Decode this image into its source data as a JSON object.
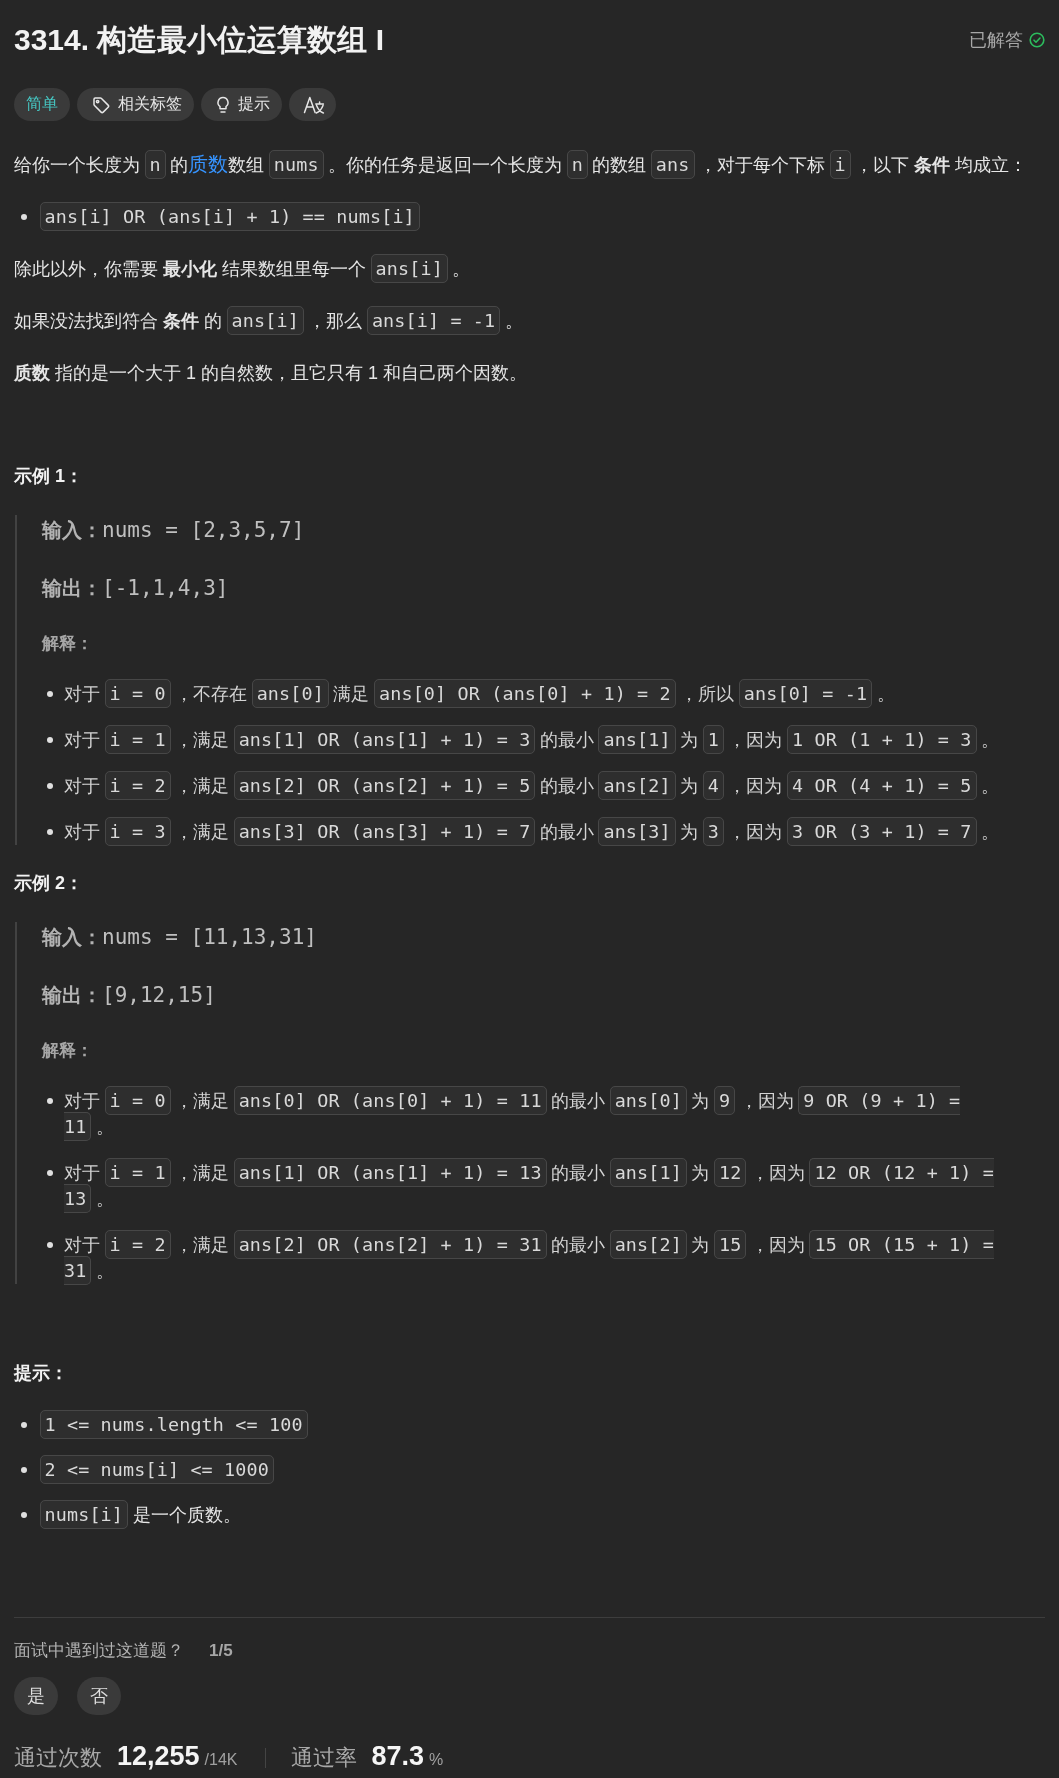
{
  "title": "3314. 构造最小位运算数组 I",
  "status": {
    "label": "已解答",
    "solved": true
  },
  "tags": [
    {
      "kind": "difficulty",
      "label": "简单"
    },
    {
      "kind": "topics",
      "label": "相关标签"
    },
    {
      "kind": "hint",
      "label": "提示"
    },
    {
      "kind": "translate"
    }
  ],
  "description": [
    {
      "kind": "paragraph",
      "segments": [
        {
          "kind": "text",
          "text": "给你一个长度为"
        },
        {
          "kind": "code",
          "text": "n"
        },
        {
          "kind": "text",
          "text": "的"
        },
        {
          "kind": "link",
          "text": "质数"
        },
        {
          "kind": "text",
          "text": "数组"
        },
        {
          "kind": "code",
          "text": "nums"
        },
        {
          "kind": "text",
          "text": "。你的任务是返回一个长度为"
        },
        {
          "kind": "code",
          "text": "n"
        },
        {
          "kind": "text",
          "text": "的数组"
        },
        {
          "kind": "code",
          "text": "ans"
        },
        {
          "kind": "text",
          "text": "，对于每个下标"
        },
        {
          "kind": "code",
          "text": "i"
        },
        {
          "kind": "text",
          "text": "，以下 **条件** 均成立："
        }
      ]
    },
    {
      "kind": "bullets",
      "items": [
        {
          "segments": [
            {
              "kind": "code",
              "text": "ans[i] OR (ans[i] + 1) == nums[i]"
            }
          ]
        }
      ]
    },
    {
      "kind": "paragraph",
      "segments": [
        {
          "kind": "text",
          "text": "除此以外，你需要 **最小化** 结果数组里每一个"
        },
        {
          "kind": "code",
          "text": "ans[i]"
        },
        {
          "kind": "text",
          "text": "。"
        }
      ]
    },
    {
      "kind": "paragraph",
      "segments": [
        {
          "kind": "text",
          "text": "如果没法找到符合 **条件** 的"
        },
        {
          "kind": "code",
          "text": "ans[i]"
        },
        {
          "kind": "text",
          "text": "，那么"
        },
        {
          "kind": "code",
          "text": "ans[i] = -1"
        },
        {
          "kind": "text",
          "text": "。"
        }
      ]
    },
    {
      "kind": "paragraph",
      "segments": [
        {
          "kind": "text",
          "text": "**质数** 指的是一个大于 1 的自然数，且它只有 1 和自己两个因数。"
        }
      ]
    }
  ],
  "examples": [
    {
      "heading": "示例 1：",
      "input_label": "输入：",
      "input": "nums = [2,3,5,7]",
      "output_label": "输出：",
      "output": "[-1,1,4,3]",
      "explanation_label": "解释：",
      "explanation": [
        {
          "segments": [
            {
              "kind": "text",
              "text": "对于"
            },
            {
              "kind": "code",
              "text": "i = 0"
            },
            {
              "kind": "text",
              "text": "，不存在"
            },
            {
              "kind": "code",
              "text": "ans[0]"
            },
            {
              "kind": "text",
              "text": "满足"
            },
            {
              "kind": "code",
              "text": "ans[0] OR (ans[0] + 1) = 2"
            },
            {
              "kind": "text",
              "text": "，所以"
            },
            {
              "kind": "code",
              "text": "ans[0] = -1"
            },
            {
              "kind": "text",
              "text": "。"
            }
          ]
        },
        {
          "segments": [
            {
              "kind": "text",
              "text": "对于"
            },
            {
              "kind": "code",
              "text": "i = 1"
            },
            {
              "kind": "text",
              "text": "，满足"
            },
            {
              "kind": "code",
              "text": "ans[1] OR (ans[1] + 1) = 3"
            },
            {
              "kind": "text",
              "text": "的最小"
            },
            {
              "kind": "code",
              "text": "ans[1]"
            },
            {
              "kind": "text",
              "text": "为"
            },
            {
              "kind": "code",
              "text": "1"
            },
            {
              "kind": "text",
              "text": "，因为"
            },
            {
              "kind": "code",
              "text": "1 OR (1 + 1) = 3"
            },
            {
              "kind": "text",
              "text": "。"
            }
          ]
        },
        {
          "segments": [
            {
              "kind": "text",
              "text": "对于"
            },
            {
              "kind": "code",
              "text": "i = 2"
            },
            {
              "kind": "text",
              "text": "，满足"
            },
            {
              "kind": "code",
              "text": "ans[2] OR (ans[2] + 1) = 5"
            },
            {
              "kind": "text",
              "text": "的最小"
            },
            {
              "kind": "code",
              "text": "ans[2]"
            },
            {
              "kind": "text",
              "text": "为"
            },
            {
              "kind": "code",
              "text": "4"
            },
            {
              "kind": "text",
              "text": "，因为"
            },
            {
              "kind": "code",
              "text": "4 OR (4 + 1) = 5"
            },
            {
              "kind": "text",
              "text": "。"
            }
          ]
        },
        {
          "segments": [
            {
              "kind": "text",
              "text": "对于"
            },
            {
              "kind": "code",
              "text": "i = 3"
            },
            {
              "kind": "text",
              "text": "，满足"
            },
            {
              "kind": "code",
              "text": "ans[3] OR (ans[3] + 1) = 7"
            },
            {
              "kind": "text",
              "text": "的最小"
            },
            {
              "kind": "code",
              "text": "ans[3]"
            },
            {
              "kind": "text",
              "text": "为"
            },
            {
              "kind": "code",
              "text": "3"
            },
            {
              "kind": "text",
              "text": "，因为"
            },
            {
              "kind": "code",
              "text": "3 OR (3 + 1) = 7"
            },
            {
              "kind": "text",
              "text": "。"
            }
          ]
        }
      ]
    },
    {
      "heading": "示例 2：",
      "input_label": "输入：",
      "input": "nums = [11,13,31]",
      "output_label": "输出：",
      "output": "[9,12,15]",
      "explanation_label": "解释：",
      "explanation": [
        {
          "segments": [
            {
              "kind": "text",
              "text": "对于"
            },
            {
              "kind": "code",
              "text": "i = 0"
            },
            {
              "kind": "text",
              "text": "，满足"
            },
            {
              "kind": "code",
              "text": "ans[0] OR (ans[0] + 1) = 11"
            },
            {
              "kind": "text",
              "text": "的最小"
            },
            {
              "kind": "code",
              "text": "ans[0]"
            },
            {
              "kind": "text",
              "text": "为"
            },
            {
              "kind": "code",
              "text": "9"
            },
            {
              "kind": "text",
              "text": "，因为"
            },
            {
              "kind": "code",
              "text": "9 OR (9 + 1) = 11"
            },
            {
              "kind": "text",
              "text": "。"
            }
          ]
        },
        {
          "segments": [
            {
              "kind": "text",
              "text": "对于"
            },
            {
              "kind": "code",
              "text": "i = 1"
            },
            {
              "kind": "text",
              "text": "，满足"
            },
            {
              "kind": "code",
              "text": "ans[1] OR (ans[1] + 1) = 13"
            },
            {
              "kind": "text",
              "text": "的最小"
            },
            {
              "kind": "code",
              "text": "ans[1]"
            },
            {
              "kind": "text",
              "text": "为"
            },
            {
              "kind": "code",
              "text": "12"
            },
            {
              "kind": "text",
              "text": "，因为"
            },
            {
              "kind": "code",
              "text": "12 OR (12 + 1) = 13"
            },
            {
              "kind": "text",
              "text": "。"
            }
          ]
        },
        {
          "segments": [
            {
              "kind": "text",
              "text": "对于"
            },
            {
              "kind": "code",
              "text": "i = 2"
            },
            {
              "kind": "text",
              "text": "，满足"
            },
            {
              "kind": "code",
              "text": "ans[2] OR (ans[2] + 1) = 31"
            },
            {
              "kind": "text",
              "text": "的最小"
            },
            {
              "kind": "code",
              "text": "ans[2]"
            },
            {
              "kind": "text",
              "text": "为"
            },
            {
              "kind": "code",
              "text": "15"
            },
            {
              "kind": "text",
              "text": "，因为"
            },
            {
              "kind": "code",
              "text": "15 OR (15 + 1) = 31"
            },
            {
              "kind": "text",
              "text": "。"
            }
          ]
        }
      ]
    }
  ],
  "constraints": {
    "heading": "提示：",
    "items": [
      {
        "segments": [
          {
            "kind": "code",
            "text": "1 <= nums.length <= 100"
          }
        ]
      },
      {
        "segments": [
          {
            "kind": "code",
            "text": "2 <= nums[i] <= 1000"
          }
        ]
      },
      {
        "segments": [
          {
            "kind": "code",
            "text": "nums[i]"
          },
          {
            "kind": "text",
            "text": "是一个质数。"
          }
        ]
      }
    ]
  },
  "feedback": {
    "question": "面试中遇到过这道题？",
    "count": "1/5",
    "buttons": [
      {
        "label": "是"
      },
      {
        "label": "否"
      }
    ]
  },
  "stats": [
    {
      "label": "通过次数",
      "value": "12,255",
      "unit": "/14K"
    },
    {
      "label": "通过率",
      "value": "87.3",
      "unit": "%"
    }
  ]
}
